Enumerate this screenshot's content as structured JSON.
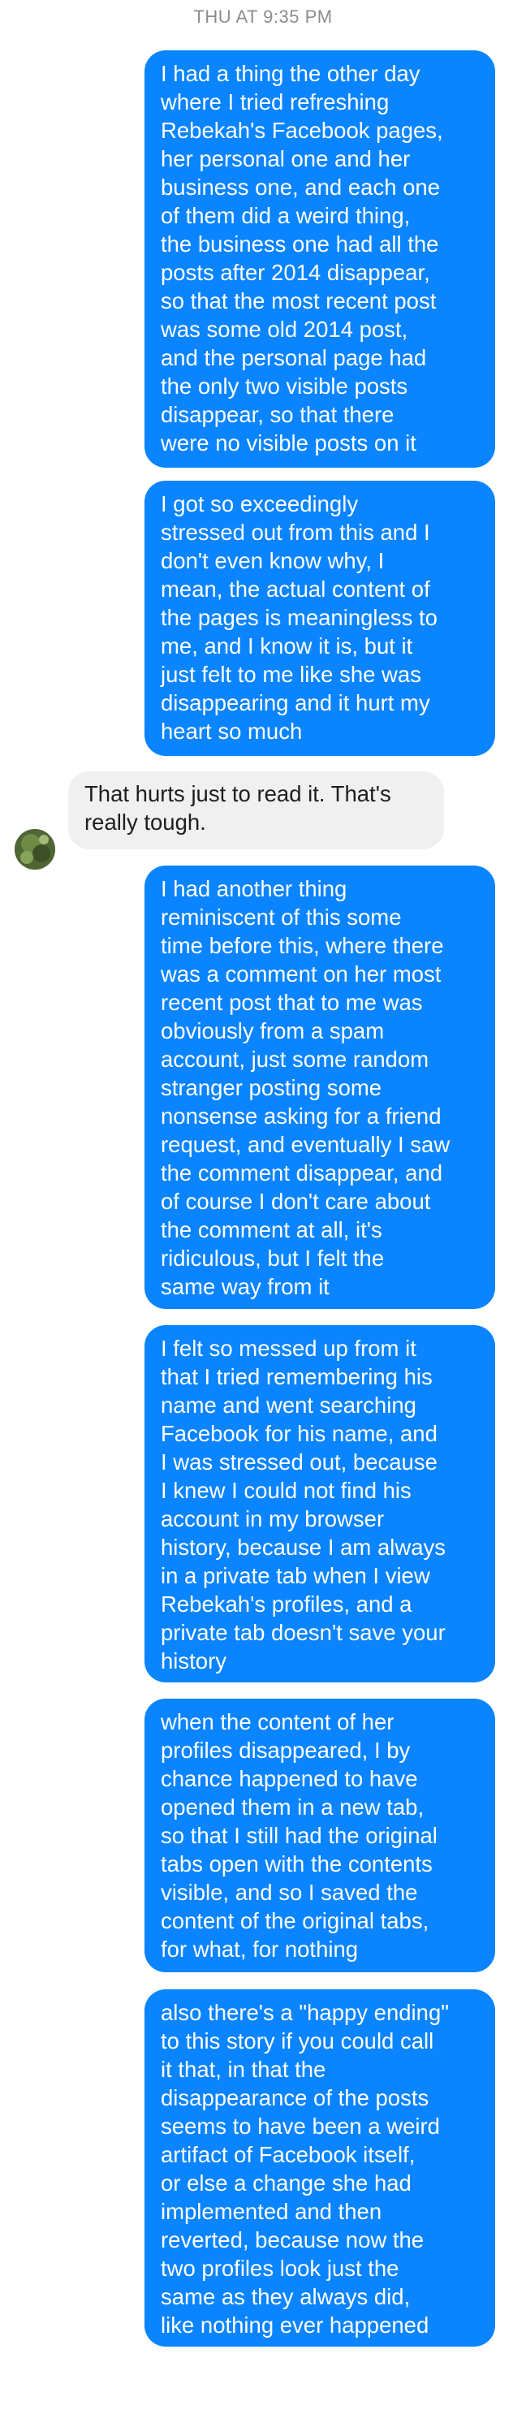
{
  "conversation": {
    "timestamp": "THU AT 9:35 PM",
    "messages": [
      {
        "sender": "me",
        "text": "I had a thing the other day\nwhere I tried refreshing\nRebekah's Facebook pages,\nher personal one and her\nbusiness one, and each one\nof them did a weird thing,\nthe business one had all the\nposts after 2014 disappear,\nso that the most recent post\nwas some old 2014 post,\nand the personal page had\nthe only two visible posts\ndisappear, so that there\nwere no visible posts on it"
      },
      {
        "sender": "me",
        "text": "I got so exceedingly\nstressed out from this and I\ndon't even know why, I\nmean, the actual content of\nthe pages is meaningless to\nme, and I know it is, but it\njust felt to me like she was\ndisappearing and it hurt my\nheart so much"
      },
      {
        "sender": "them",
        "text": "That hurts just to read it. That's\nreally tough."
      },
      {
        "sender": "me",
        "text": "I had another thing\nreminiscent of this some\ntime before this, where there\nwas a comment on her most\nrecent post that to me was\nobviously from a spam\naccount, just some random\nstranger posting some\nnonsense asking for a friend\nrequest, and eventually I saw\nthe comment disappear, and\nof course I don't care about\nthe comment at all, it's\nridiculous, but I felt the\nsame way from it"
      },
      {
        "sender": "me",
        "text": "I felt so messed up from it\nthat I tried remembering his\nname and went searching\nFacebook for his name, and\nI was stressed out, because\nI knew I could not find his\naccount in my browser\nhistory, because I am always\nin a private tab when I view\nRebekah's profiles, and a\nprivate tab doesn't save your\nhistory"
      },
      {
        "sender": "me",
        "text": "when the content of her\nprofiles disappeared, I by\nchance happened to have\nopened them in a new tab,\nso that I still had the original\ntabs open with the contents\nvisible, and so I saved the\ncontent of the original tabs,\nfor what, for nothing"
      },
      {
        "sender": "me",
        "text": "also there's a \"happy ending\"\nto this story if you could call\nit that, in that the\ndisappearance of the posts\nseems to have been a weird\nartifact of Facebook itself,\nor else a change she had\nimplemented and then\nreverted, because now the\ntwo profiles look just the\nsame as they always did,\nlike nothing ever happened"
      }
    ]
  },
  "colors": {
    "outgoing_bubble": "#0a84ff",
    "incoming_bubble": "#f0f0f0",
    "timestamp_text": "#8a8d91"
  },
  "icons": {
    "contact_avatar": "avatar-icon"
  }
}
